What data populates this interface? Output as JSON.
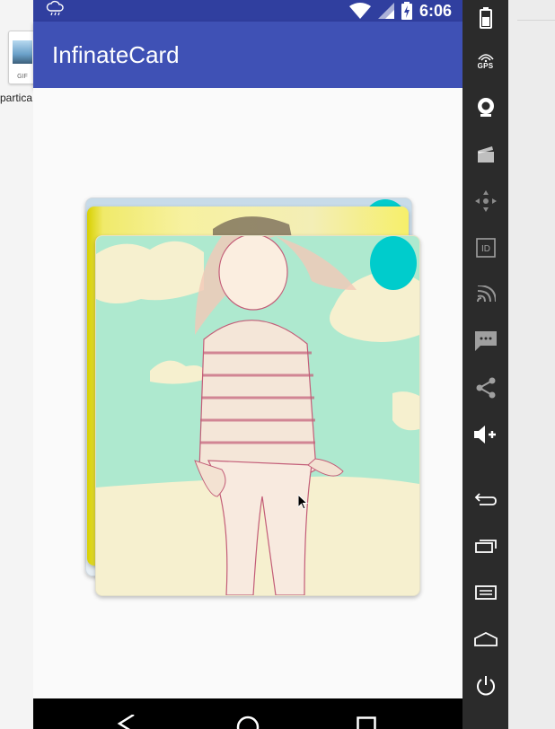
{
  "host": {
    "file_icon_ext": "GIF",
    "file_label": "partica"
  },
  "status_bar": {
    "time": "6:06",
    "icons": [
      "weather-cloud-icon",
      "wifi-icon",
      "signal-icon",
      "battery-charging-icon"
    ]
  },
  "app_bar": {
    "title": "InfinateCard"
  },
  "cards": {
    "count_visible": 3,
    "badge_color": "#00cccc"
  },
  "emulator_toolbar": {
    "items": [
      {
        "icon": "battery-icon"
      },
      {
        "icon": "gps-icon",
        "label": "GPS"
      },
      {
        "icon": "camera-icon"
      },
      {
        "icon": "clapper-icon"
      },
      {
        "icon": "dpad-icon"
      },
      {
        "icon": "id-icon",
        "label": "ID"
      },
      {
        "icon": "cast-icon"
      },
      {
        "icon": "sms-icon"
      },
      {
        "icon": "share-icon"
      },
      {
        "icon": "volume-up-icon"
      },
      {
        "icon": "back-icon"
      },
      {
        "icon": "recents-icon"
      },
      {
        "icon": "menu-icon"
      },
      {
        "icon": "home-icon"
      },
      {
        "icon": "power-icon"
      }
    ]
  },
  "nav_bar": {
    "buttons": [
      "nav-back-icon",
      "nav-home-icon",
      "nav-recents-icon"
    ]
  },
  "colors": {
    "primary": "#3f51b5",
    "primary_dark": "#303f9f",
    "accent": "#00cccc"
  }
}
